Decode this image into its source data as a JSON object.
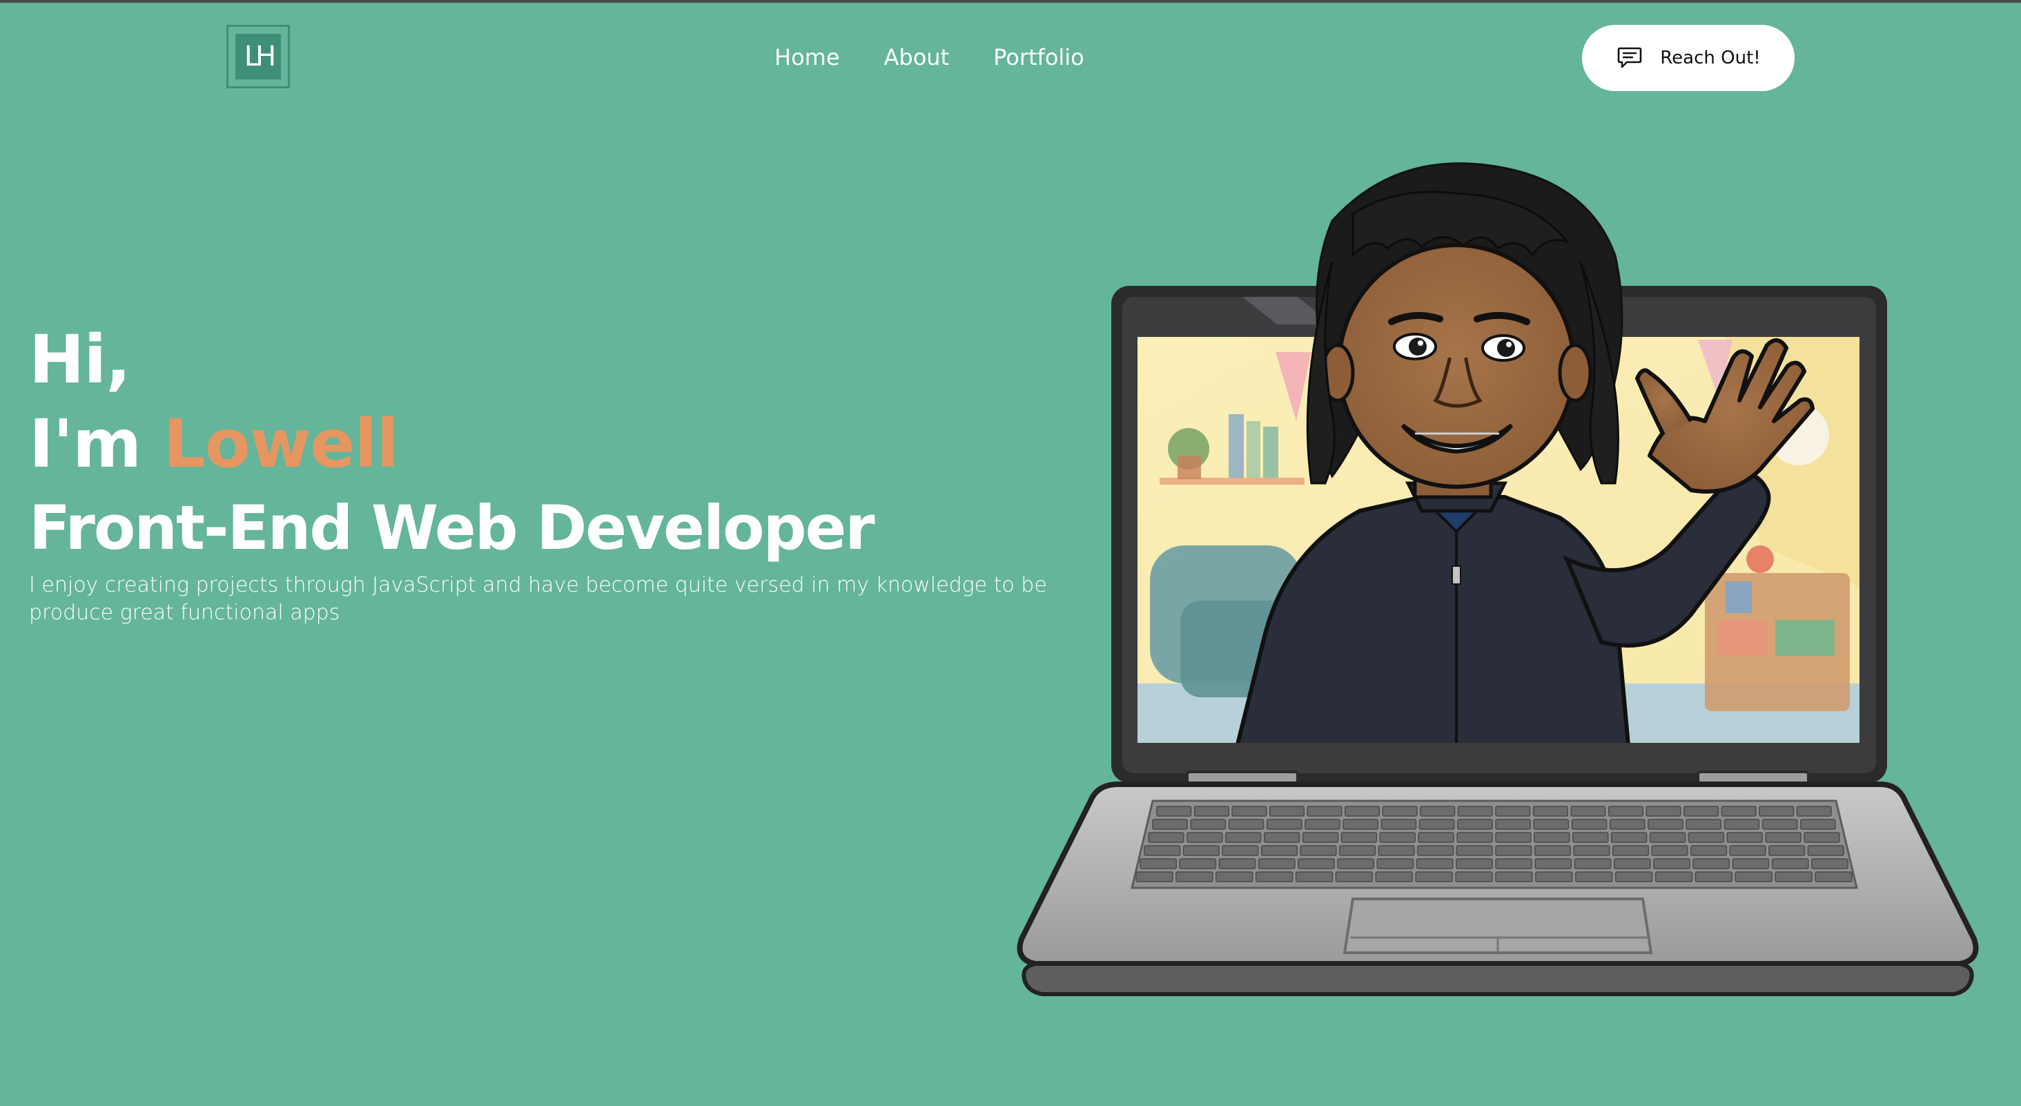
{
  "brand": {
    "logo_text": "LH"
  },
  "nav": {
    "items": [
      {
        "label": "Home"
      },
      {
        "label": "About"
      },
      {
        "label": "Portfolio"
      }
    ]
  },
  "cta": {
    "label": "Reach Out!",
    "icon": "chat-bubble-icon"
  },
  "hero": {
    "greeting": "Hi,",
    "intro_prefix": "I'm ",
    "name": "Lowell",
    "role": "Front-End Web Developer",
    "description": "I enjoy creating projects through JavaScript and have become quite versed in my knowledge to be produce great functional apps"
  },
  "colors": {
    "background": "#64b59a",
    "accent": "#e69661",
    "logo": "#3f8f78",
    "text": "#ffffff"
  }
}
